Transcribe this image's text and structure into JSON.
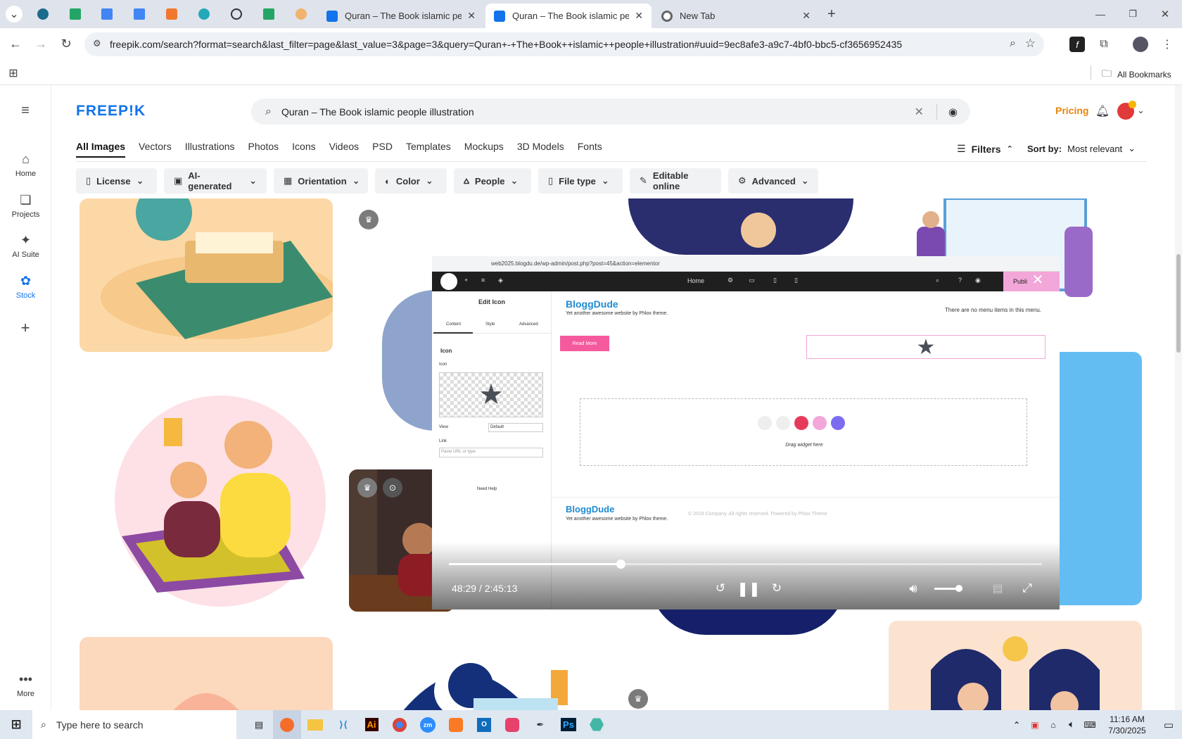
{
  "browser": {
    "tabs": [
      {
        "title": "Quran – The Book islamic people",
        "active": false
      },
      {
        "title": "Quran – The Book islamic people",
        "active": true
      },
      {
        "title": "New Tab",
        "active": false
      }
    ],
    "url": "freepik.com/search?format=search&last_filter=page&last_value=3&page=3&query=Quran+-+The+Book++islamic++people+illustration#uuid=9ec8afe3-a9c7-4bf0-bbc5-cf3656952435",
    "bookmarks_label": "All Bookmarks"
  },
  "sidebar": {
    "items": [
      {
        "label": "Home",
        "icon": "home-icon"
      },
      {
        "label": "Projects",
        "icon": "projects-icon"
      },
      {
        "label": "AI Suite",
        "icon": "ai-suite-icon"
      },
      {
        "label": "Stock",
        "icon": "stock-icon"
      }
    ],
    "more_label": "More"
  },
  "header": {
    "logo": "FREEP!K",
    "search_value": "Quran – The Book  islamic  people illustration",
    "pricing": "Pricing"
  },
  "nav_tabs": [
    "All Images",
    "Vectors",
    "Illustrations",
    "Photos",
    "Icons",
    "Videos",
    "PSD",
    "Templates",
    "Mockups",
    "3D Models",
    "Fonts"
  ],
  "filters_label": "Filters",
  "sort": {
    "label": "Sort by:",
    "value": "Most relevant"
  },
  "chips": [
    "License",
    "AI-generated",
    "Orientation",
    "Color",
    "People",
    "File type",
    "Editable online",
    "Advanced"
  ],
  "video": {
    "inner_url": "web2025.blogdu.de/wp-admin/post.php?post=45&action=elementor",
    "home_menu": "Home",
    "publish": "Publi",
    "panel_title": "Edit Icon",
    "panel_tabs": [
      "Content",
      "Style",
      "Advanced"
    ],
    "section": "Icon",
    "icon_label": "Icon",
    "view_label": "View",
    "view_value": "Default",
    "link_label": "Link",
    "link_placeholder": "Paste URL or type",
    "need_help": "Need Help",
    "site_title": "BloggDude",
    "site_tagline": "Yet another awesome website by Phlox theme.",
    "menu_note": "There are no menu items in this menu.",
    "read_more": "Read More",
    "drag_hint": "Drag widget here",
    "footer_title": "BloggDude",
    "footer_tagline": "Yet another awesome website by Phlox theme.",
    "footer_copy": "© 2019 Company. All rights reserved.  Powered by  Phlox Theme",
    "time": "48:29 / 2:45:13",
    "progress": 0.29
  },
  "taskbar": {
    "search_placeholder": "Type here to search",
    "time": "11:16 AM",
    "date": "7/30/2025"
  },
  "colors": {
    "freepik_blue": "#1273eb",
    "pricing": "#e7850f",
    "read_more": "#f55a9e",
    "elementor_pink": "#f3a6d9"
  }
}
